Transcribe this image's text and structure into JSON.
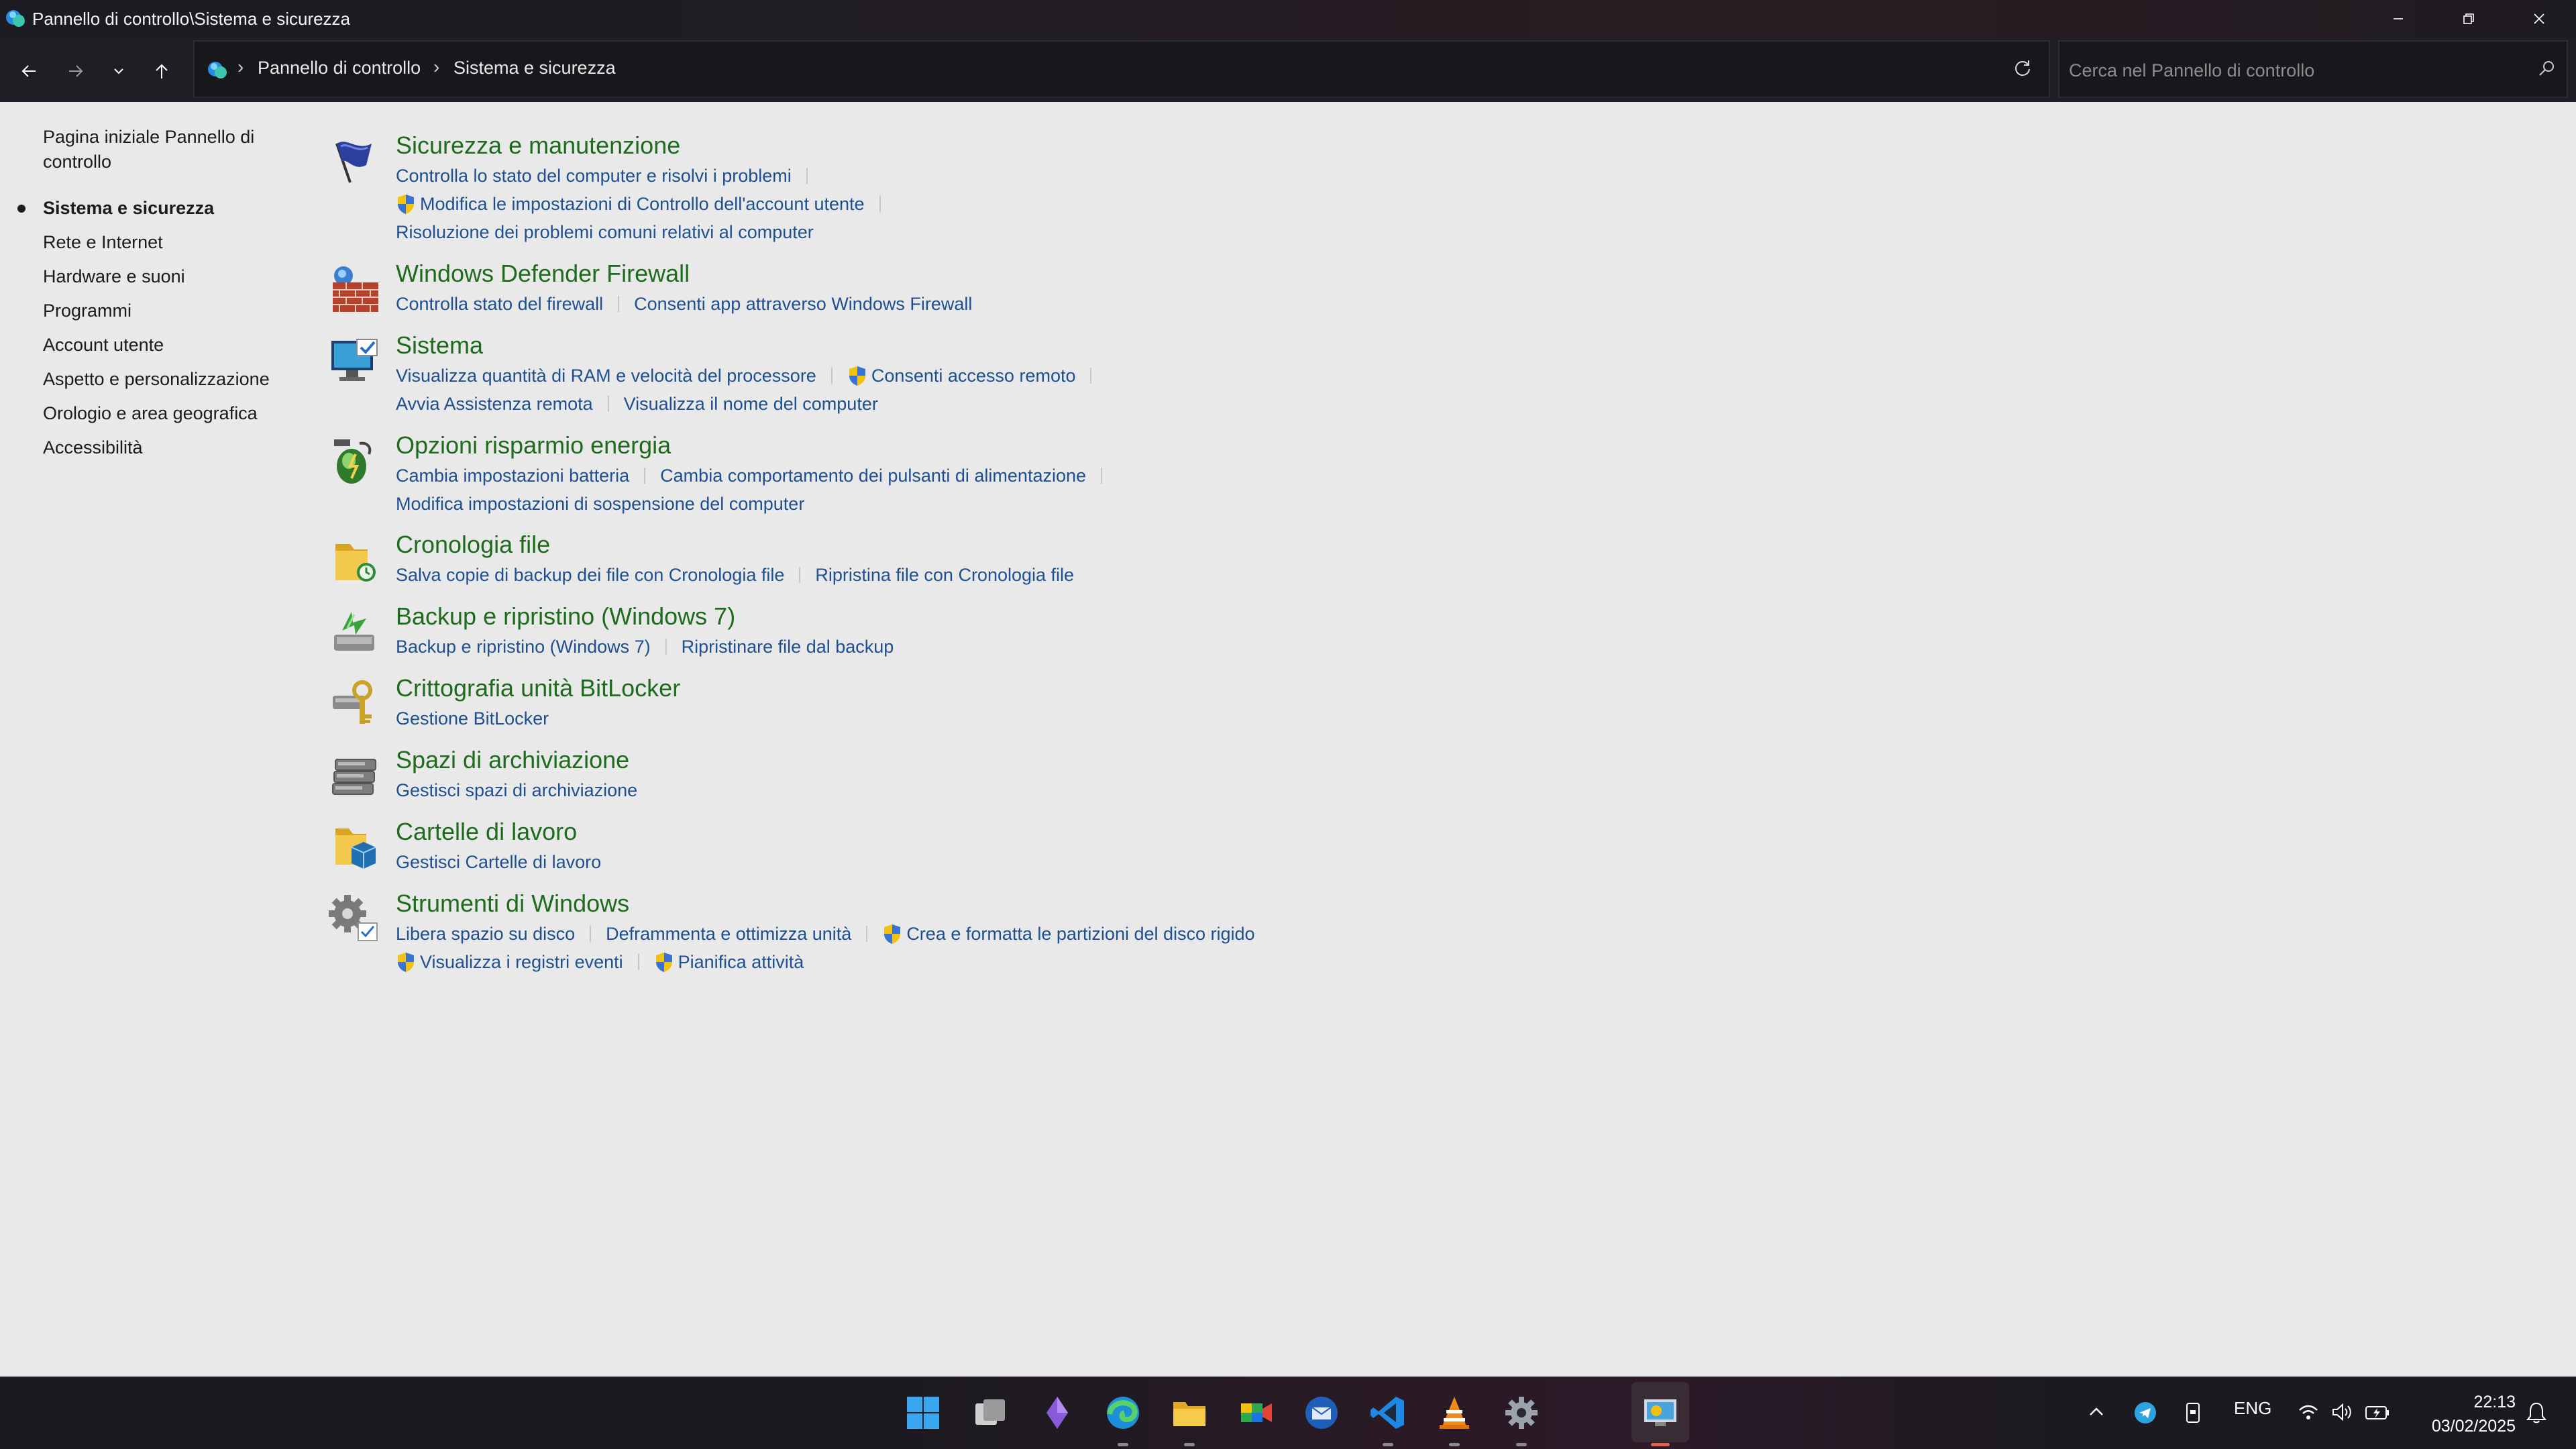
{
  "window": {
    "title": "Pannello di controllo\\Sistema e sicurezza"
  },
  "address": {
    "crumbs": [
      "Pannello di controllo",
      "Sistema e sicurezza"
    ],
    "search_placeholder": "Cerca nel Pannello di controllo"
  },
  "leftnav": {
    "home": "Pagina iniziale Pannello di controllo",
    "items": [
      {
        "label": "Sistema e sicurezza",
        "current": true
      },
      {
        "label": "Rete e Internet"
      },
      {
        "label": "Hardware e suoni"
      },
      {
        "label": "Programmi"
      },
      {
        "label": "Account utente"
      },
      {
        "label": "Aspetto e personalizzazione"
      },
      {
        "label": "Orologio e area geografica"
      },
      {
        "label": "Accessibilità"
      }
    ]
  },
  "categories": [
    {
      "title": "Sicurezza e manutenzione",
      "icon": "flag-icon",
      "links": [
        {
          "label": "Controlla lo stato del computer e risolvi i problemi"
        },
        {
          "label": "Modifica le impostazioni di Controllo dell'account utente",
          "shield": true
        },
        {
          "label": "Risoluzione dei problemi comuni relativi al computer"
        }
      ]
    },
    {
      "title": "Windows Defender Firewall",
      "icon": "firewall-icon",
      "links": [
        {
          "label": "Controlla stato del firewall"
        },
        {
          "label": "Consenti app attraverso Windows Firewall"
        }
      ]
    },
    {
      "title": "Sistema",
      "icon": "monitor-icon",
      "links": [
        {
          "label": "Visualizza quantità di RAM e velocità del processore"
        },
        {
          "label": "Consenti accesso remoto",
          "shield": true
        },
        {
          "label": "Avvia Assistenza remota"
        },
        {
          "label": "Visualizza il nome del computer"
        }
      ]
    },
    {
      "title": "Opzioni risparmio energia",
      "icon": "battery-icon",
      "links": [
        {
          "label": "Cambia impostazioni batteria"
        },
        {
          "label": "Cambia comportamento dei pulsanti di alimentazione"
        },
        {
          "label": "Modifica impostazioni di sospensione del computer"
        }
      ]
    },
    {
      "title": "Cronologia file",
      "icon": "file-history-icon",
      "links": [
        {
          "label": "Salva copie di backup dei file con Cronologia file"
        },
        {
          "label": "Ripristina file con Cronologia file"
        }
      ]
    },
    {
      "title": "Backup e ripristino (Windows 7)",
      "icon": "backup-icon",
      "links": [
        {
          "label": "Backup e ripristino (Windows 7)"
        },
        {
          "label": "Ripristinare file dal backup"
        }
      ]
    },
    {
      "title": "Crittografia unità BitLocker",
      "icon": "bitlocker-icon",
      "links": [
        {
          "label": "Gestione BitLocker"
        }
      ]
    },
    {
      "title": "Spazi di archiviazione",
      "icon": "storage-spaces-icon",
      "links": [
        {
          "label": "Gestisci spazi di archiviazione"
        }
      ]
    },
    {
      "title": "Cartelle di lavoro",
      "icon": "work-folders-icon",
      "links": [
        {
          "label": "Gestisci Cartelle di lavoro"
        }
      ]
    },
    {
      "title": "Strumenti di Windows",
      "icon": "windows-tools-icon",
      "links": [
        {
          "label": "Libera spazio su disco"
        },
        {
          "label": "Deframmenta e ottimizza unità"
        },
        {
          "label": "Crea e formatta le partizioni del disco rigido",
          "shield": true
        },
        {
          "label": "Visualizza i registri eventi",
          "shield": true
        },
        {
          "label": "Pianifica attività",
          "shield": true
        }
      ]
    }
  ],
  "tray": {
    "language": "ENG",
    "time": "22:13",
    "date": "03/02/2025"
  },
  "colors": {
    "heading": "#1e6b1e",
    "link": "#1d4f91",
    "content_bg": "#e9e9e9"
  }
}
